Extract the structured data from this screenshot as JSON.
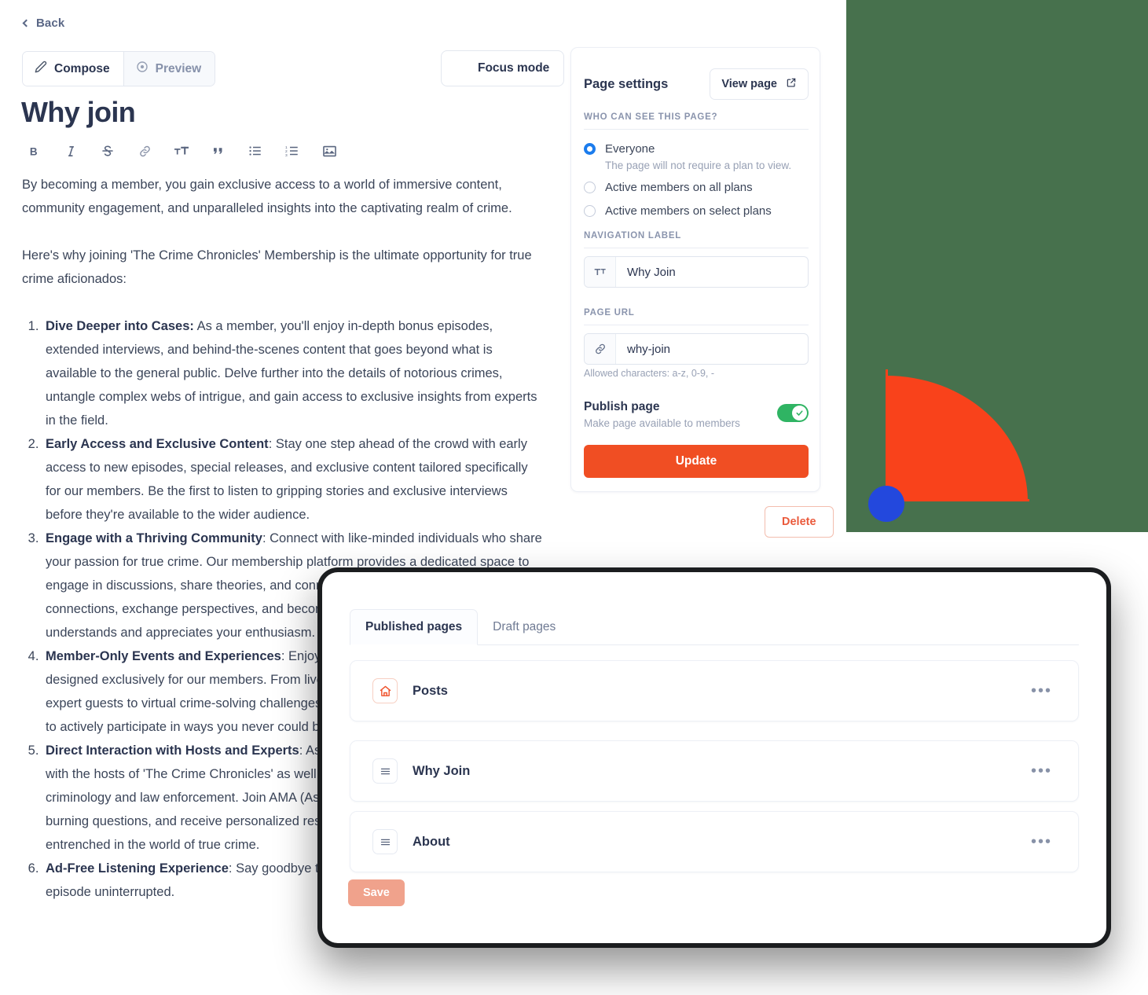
{
  "editor": {
    "back_label": "Back",
    "compose_label": "Compose",
    "preview_label": "Preview",
    "focus_label": "Focus mode",
    "doc_title": "Why join",
    "toolbar_icons": [
      "bold-icon",
      "italic-icon",
      "strikethrough-icon",
      "link-icon",
      "heading-size-icon",
      "blockquote-icon",
      "bulleted-list-icon",
      "numbered-list-icon",
      "image-icon"
    ],
    "paragraphs": [
      "By becoming a member, you gain exclusive access to a world of immersive content, community engagement, and unparalleled insights into the captivating realm of crime.",
      "Here's why joining 'The Crime Chronicles' Membership is the ultimate opportunity for true crime aficionados:"
    ],
    "list_items": [
      {
        "lead": "Dive Deeper into Cases:",
        "text": " As a member, you'll enjoy in-depth bonus episodes, extended interviews, and behind-the-scenes content that goes beyond what is available to the general public. Delve further into the details of notorious crimes, untangle complex webs of intrigue, and gain access to exclusive insights from experts in the field."
      },
      {
        "lead": "Early Access and Exclusive Content",
        "text": ": Stay one step ahead of the crowd with early access to new episodes, special releases, and exclusive content tailored specifically for our members. Be the first to listen to gripping stories and exclusive interviews before they're available to the wider audience."
      },
      {
        "lead": "Engage with a Thriving Community",
        "text": ": Connect with like-minded individuals who share your passion for true crime. Our membership platform provides a dedicated space to engage in discussions, share theories, and connect with fellow enthusiasts. Forge new connections, exchange perspectives, and become part of a community that understands and appreciates your enthusiasm."
      },
      {
        "lead": "Member-Only Events and Experiences",
        "text": ": Enjoy exclusive events and experiences designed exclusively for our members. From live Q&A sessions with the hosts and expert guests to virtual crime-solving challenges, these unique opportunities allow you to actively participate in ways you never could before."
      },
      {
        "lead": "Direct Interaction with Hosts and Experts",
        "text": ": As a member, you get to engage directly with the hosts of 'The Crime Chronicles' as well as leading experts in the field of criminology and law enforcement. Join AMA (Ask Me Anything) sessions, submit your burning questions, and receive personalized responses from those who are deeply entrenched in the world of true crime."
      },
      {
        "lead": "Ad-Free Listening Experience",
        "text": ": Say goodbye to interruptions and enjoy every episode uninterrupted."
      }
    ]
  },
  "settings": {
    "title": "Page settings",
    "view_page_label": "View page",
    "view_page_icon": "external-link-icon",
    "visibility_heading": "WHO CAN SEE THIS PAGE?",
    "visibility_options": [
      {
        "label": "Everyone",
        "sub": "The page will not require a plan to view.",
        "selected": true
      },
      {
        "label": "Active members on all plans",
        "sub": "",
        "selected": false
      },
      {
        "label": "Active members on select plans",
        "sub": "",
        "selected": false
      }
    ],
    "nav_label_heading": "NAVIGATION LABEL",
    "nav_label_icon": "text-format-icon",
    "nav_label_value": "Why Join",
    "page_url_heading": "PAGE URL",
    "page_url_icon": "link-icon",
    "page_url_value": "why-join",
    "page_url_hint": "Allowed characters: a-z, 0-9, -",
    "publish_title": "Publish page",
    "publish_sub": "Make page available to members",
    "publish_on": true,
    "update_label": "Update",
    "delete_label": "Delete",
    "accent_color": "#f04e23",
    "radio_color": "#1b7ced",
    "toggle_color": "#2fb463",
    "delete_color": "#ea5a3c"
  },
  "pages_modal": {
    "tabs": [
      {
        "label": "Published pages",
        "active": true
      },
      {
        "label": "Draft pages",
        "active": false
      }
    ],
    "rows": [
      {
        "title": "Posts",
        "icon": "home-icon",
        "menu": "•••"
      },
      {
        "title": "Why Join",
        "icon": "hamburger-page-icon",
        "menu": "•••"
      },
      {
        "title": "About",
        "icon": "hamburger-page-icon",
        "menu": "•••"
      }
    ],
    "save_label": "Save",
    "save_disabled": true
  },
  "decoration": {
    "background_color": "#47714d",
    "shape_color": "#f9421b",
    "circle_color": "#2348dd"
  }
}
